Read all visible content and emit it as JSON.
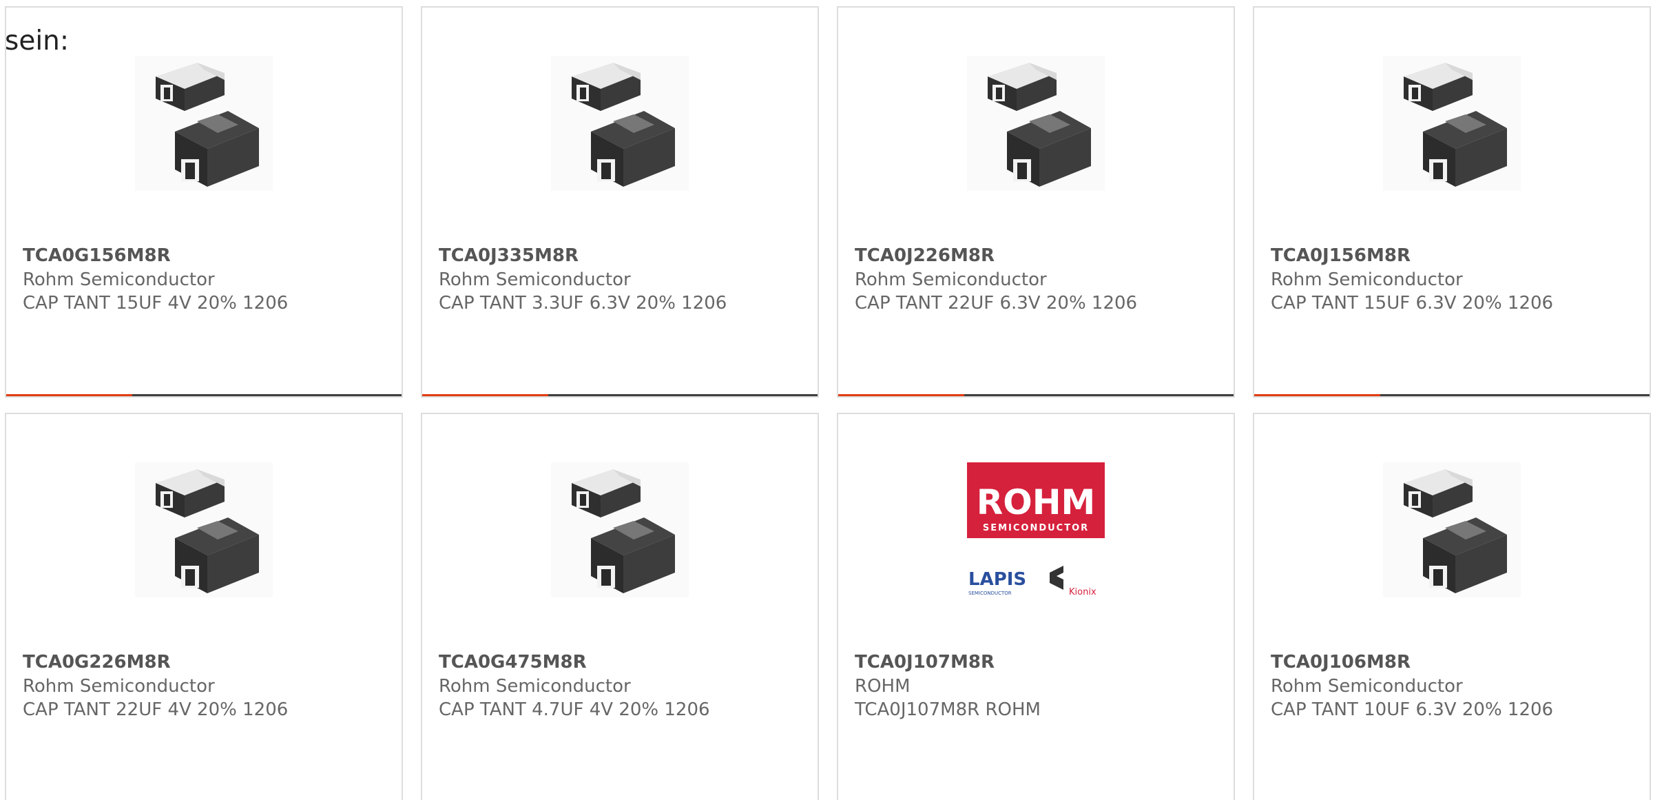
{
  "intro_text": "sein:",
  "accent_color": "#e03d12",
  "bar_color": "#3e3e3e",
  "cards": [
    {
      "part": "TCA0G156M8R",
      "manufacturer": "Rohm Semiconductor",
      "description": "CAP TANT 15UF 4V 20% 1206",
      "image": "tantalum-capacitor-image"
    },
    {
      "part": "TCA0J335M8R",
      "manufacturer": "Rohm Semiconductor",
      "description": "CAP TANT 3.3UF 6.3V 20% 1206",
      "image": "tantalum-capacitor-image"
    },
    {
      "part": "TCA0J226M8R",
      "manufacturer": "Rohm Semiconductor",
      "description": "CAP TANT 22UF 6.3V 20% 1206",
      "image": "tantalum-capacitor-image"
    },
    {
      "part": "TCA0J156M8R",
      "manufacturer": "Rohm Semiconductor",
      "description": "CAP TANT 15UF 6.3V 20% 1206",
      "image": "tantalum-capacitor-image"
    },
    {
      "part": "TCA0G226M8R",
      "manufacturer": "Rohm Semiconductor",
      "description": "CAP TANT 22UF 4V 20% 1206",
      "image": "tantalum-capacitor-image"
    },
    {
      "part": "TCA0G475M8R",
      "manufacturer": "Rohm Semiconductor",
      "description": "CAP TANT 4.7UF 4V 20% 1206",
      "image": "tantalum-capacitor-image"
    },
    {
      "part": "TCA0J107M8R",
      "manufacturer": "ROHM",
      "description": "TCA0J107M8R ROHM",
      "image": "rohm-logo",
      "logo": {
        "brand": "ROHM",
        "brand_sub": "SEMICONDUCTOR",
        "lapis": "LAPIS",
        "lapis_sub": "SEMICONDUCTOR",
        "kionix": "Kionix"
      }
    },
    {
      "part": "TCA0J106M8R",
      "manufacturer": "Rohm Semiconductor",
      "description": "CAP TANT 10UF 6.3V 20% 1206",
      "image": "tantalum-capacitor-image"
    }
  ]
}
